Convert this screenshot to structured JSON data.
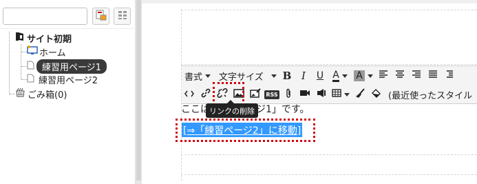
{
  "tree": {
    "root": {
      "label": "サイト初期",
      "icon": "site-root-icon"
    },
    "items": [
      {
        "label": "ホーム",
        "icon": "home-monitor-icon"
      },
      {
        "label": "練習用ページ1",
        "icon": "page-icon",
        "selected": true
      },
      {
        "label": "練習用ページ2",
        "icon": "page-icon"
      }
    ],
    "trash": {
      "label": "ごみ箱(0)",
      "icon": "trash-icon"
    }
  },
  "toolbar": {
    "format_label": "書式",
    "font_size_label": "文字サイズ",
    "bold_label": "B",
    "italic_label": "I",
    "underline_label": "U",
    "font_color_label": "A",
    "bg_color_label": "A",
    "rss_label": "RSS",
    "recent_styles_label": "(最近使ったスタイル"
  },
  "tooltip": {
    "text": "リンクの削除"
  },
  "content": {
    "line1_prefix": "ここは",
    "line1_suffix": "ジ1」です。",
    "link_text": "[⇒「練習ページ2」に移動]"
  },
  "colors": {
    "highlight_red": "#d0000f",
    "selection_blue": "#3399ff",
    "tooltip_bg": "#222222",
    "selected_tree_bg": "#3a3a3a"
  }
}
